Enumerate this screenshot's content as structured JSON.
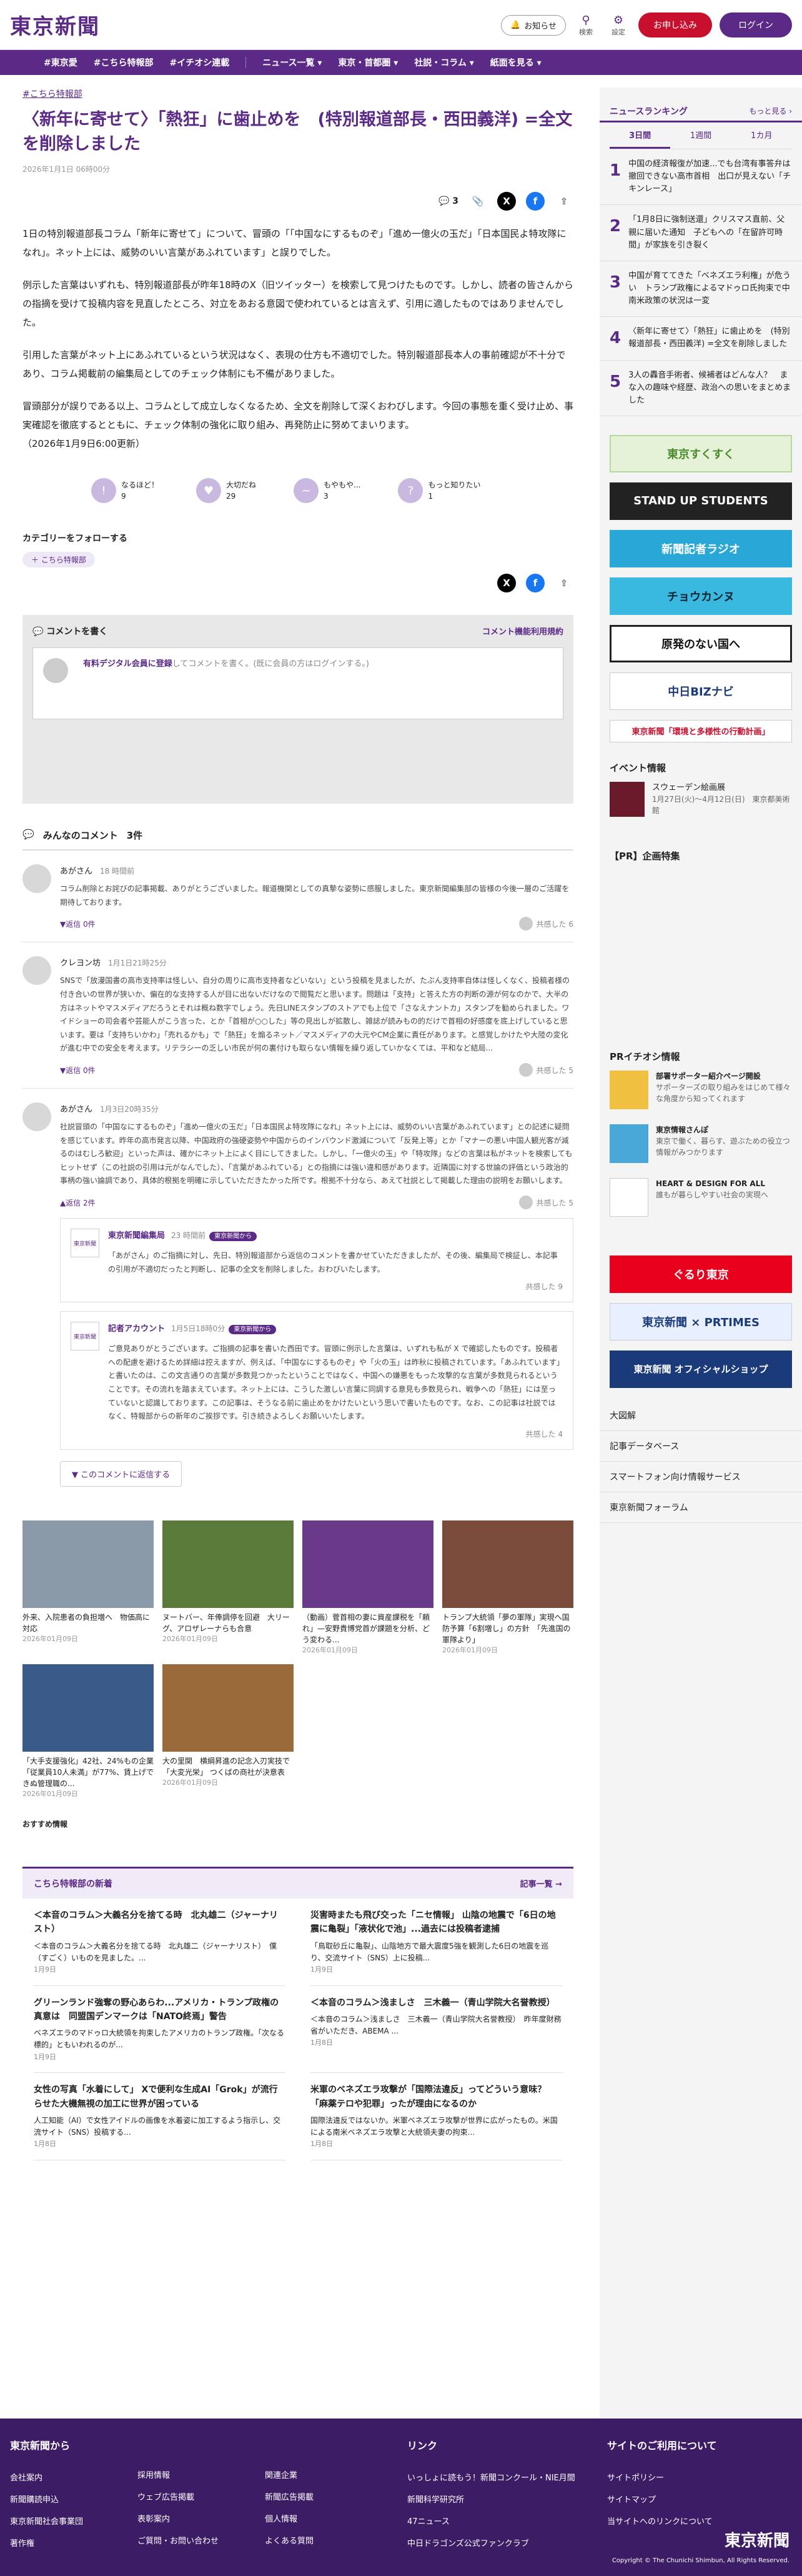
{
  "header": {
    "logo": "東京新聞",
    "notify": "お知らせ",
    "search": "検索",
    "settings": "設定",
    "apply": "お申し込み",
    "login": "ログイン"
  },
  "nav": [
    "#東京愛",
    "#こちら特報部",
    "#イチオシ連載",
    "ニュース一覧 ▾",
    "東京・首都圏 ▾",
    "社説・コラム ▾",
    "紙面を見る ▾"
  ],
  "article": {
    "category": "#こちら特報部",
    "title": "〈新年に寄せて〉「熱狂」に歯止めを　(特別報道部長・西田義洋) =全文を削除しました",
    "date": "2026年1月1日 06時00分",
    "comment_count": "3",
    "paragraphs": [
      "1日の特別報道部長コラム「新年に寄せて」について、冒頭の「「中国なにするものぞ」「進め一億火の玉だ」「日本国民よ特攻隊になれ」。ネット上には、威勢のいい言葉があふれています」と誤りでした。",
      "例示した言葉はいずれも、特別報道部長が昨年18時のX（旧ツイッター）を検索して見つけたものです。しかし、読者の皆さんからの指摘を受けて投稿内容を見直したところ、対立をあおる意図で使われているとは言えず、引用に適したものではありませんでした。",
      "引用した言葉がネット上にあふれているという状況はなく、表現の仕方も不適切でした。特別報道部長本人の事前確認が不十分であり、コラム掲載前の編集局としてのチェック体制にも不備がありました。",
      "冒頭部分が誤りである以上、コラムとして成立しなくなるため、全文を削除して深くおわびします。今回の事態を重く受け止め、事実確認を徹底するとともに、チェック体制の強化に取り組み、再発防止に努めてまいります。",
      "（2026年1月9日6:00更新）"
    ],
    "reactions": [
      {
        "label": "なるほど！",
        "count": "9",
        "icon": "!"
      },
      {
        "label": "大切だね",
        "count": "29",
        "icon": "♥"
      },
      {
        "label": "もやもや...",
        "count": "3",
        "icon": "~"
      },
      {
        "label": "もっと知りたい",
        "count": "1",
        "icon": "?"
      }
    ],
    "follow_label": "カテゴリーをフォローする",
    "follow_chip": "＋ こちら特報部"
  },
  "comment_box": {
    "heading": "コメントを書く",
    "policy_link": "コメント機能利用規約",
    "prompt_member": "有料デジタル会員に登録",
    "prompt_rest": "してコメントを書く。(既に会員の方はログインする。)"
  },
  "comments_section": {
    "heading": "みんなのコメント",
    "count": "3件"
  },
  "comments": [
    {
      "name": "あがさん",
      "time": "18 時間前",
      "text": "コラム削除とお詫びの記事掲載、ありがとうございました。報道機関としての真摯な姿勢に感服しました。東京新聞編集部の皆様の今後一層のご活躍を期待しております。",
      "reply": "▼返信 0件",
      "agree": "共感した 6"
    },
    {
      "name": "クレヨン坊",
      "time": "1月1日21時25分",
      "text": "SNSで「放漫国書の高市支持率は怪しい、自分の周りに高市支持者などいない」という投稿を見ましたが、たぶん支持率自体は怪しくなく、投稿者様の付き合いの世界が狭いか、偏在的な支持する人が目に出ないだけなので閲覧だと思います。問題は「支持」と答えた方の判断の源が何なのかで、大半の方はネットやマスメディアだろうとそれは概ね数字でしょう。先日LINEスタンプのストアでも上位で「さなえナントカ」スタンプを勧められました。ワイドショーの司会者や芸能人がこう言った、とか「首相が○○した」等の見出しが拡散し、雑誌が読みもの的だけで首相の好感度を底上げしていると思います。要は「支持ちいかわ」「売れるかも」で「熱狂」を煽るネット／マスメディアの大元やCM企業に責任があります。と感覚しかけたや大陸の変化が進む中での安全を考えます。リテラシーの乏しい市民が何の裏付けも取らない情報を繰り返していかなくては、平和など結局...",
      "reply": "▼返信 0件",
      "agree": "共感した 5"
    },
    {
      "name": "あがさん",
      "time": "1月3日20時35分",
      "text": "社説冒頭の「中国なにするものぞ」「進め一億火の玉だ」「日本国民よ特攻隊になれ」ネット上には、威勢のいい言葉があふれています」との記述に疑問を感じています。昨年の高市発言以降、中国政府の強硬姿勢や中国からのインバウンド激減について「反発上等」とか「マナーの悪い中国人観光客が減るのはむしろ歓迎」といった声は、確かにネット上によく目にしてきました。しかし、「一億火の玉」や「特攻隊」などの言葉は私がネットを検索してもヒットせず（この社説の引用は元がなんでした）、「言葉があふれている」との指摘には強い違和感があります。近隣国に対する世論の評価という政治的事柄の強い論調であり、具体的根拠を明確に示していただきたかった所です。根拠不十分なら、あえて社説として掲載した理由の説明をお願いします。",
      "reply": "▲返信 2件",
      "agree": "共感した 5"
    }
  ],
  "replies": [
    {
      "name": "東京新聞編集局",
      "time": "23 時間前",
      "tag": "東京新聞から",
      "text": "「あがさん」のご指摘に対し、先日、特別報道部から返信のコメントを書かせていただきましたが、その後、編集局で検証し、本記事の引用が不適切だったと判断し、記事の全文を削除しました。おわびいたします。",
      "agree": "共感した 9"
    },
    {
      "name": "記者アカウント",
      "time": "1月5日18時0分",
      "tag": "東京新聞から",
      "text": "ご意見ありがとうございます。ご指摘の記事を書いた西田です。冒頭に例示した言葉は、いずれも私が X で確認したものです。投稿者への配慮を避けるため詳細は控えますが、例えば、「中国なにするものぞ」や「火の玉」は昨秋に投稿されています。「あふれています」と書いたのは、この文言通りの言葉が多数見つかったということではなく、中国への嫌悪をもった攻撃的な言葉が多数見られるということです。その流れを踏まえています。ネット上には、こうした激しい言葉に同調する意見も多数見られ、戦争への「熱狂」には至っていないと認識しております。この記事は、そうなる前に歯止めをかけたいという思いで書いたものです。なお、この記事は社説ではなく、特報部からの新年のご挨拶です。引き続きよろしくお願いいたします。",
      "agree": "共感した 4"
    }
  ],
  "more_replies": "▼ このコメントに返信する",
  "related": [
    {
      "title": "外来、入院患者の負担増へ　物価高に対応",
      "date": "2026年01月09日",
      "color": "#8a9aa8"
    },
    {
      "title": "ヌートバー、年俸調停を回避　大リーグ、アロザレーナらも合意",
      "date": "2026年01月09日",
      "color": "#5a7a3a"
    },
    {
      "title": "（動画）菅首相の妻に資産課税を「頼れ」—安野貴博党首が課題を分析、どう変わる...",
      "date": "2026年01月09日",
      "color": "#6a3a8a"
    },
    {
      "title": "トランプ大統領「夢の軍隊」実現へ国防予算「6割増し」の方針　「先進国の軍隊より」",
      "date": "2026年01月09日",
      "color": "#7a4a3a"
    },
    {
      "title": "「大手支援強化」42社、24%もの企業「従業員10人未満」が77%、賃上げできぬ管理職の...",
      "date": "2026年01月09日",
      "color": "#3a5a8a"
    },
    {
      "title": "大の里関　横綱昇進の記念入刃実技で「大変光栄」 つくばの商社が決意表",
      "date": "2026年01月09日",
      "color": "#9a6a3a"
    }
  ],
  "recommend_label": "おすすめ情報",
  "latest": {
    "heading": "こちら特報部の新着",
    "more": "記事一覧 →",
    "items": [
      {
        "title": "＜本音のコラム＞大義名分を捨てる時　北丸雄二（ジャーナリスト）",
        "text": "＜本音のコラム＞大義名分を捨てる時　北丸雄二（ジャーナリスト）　僕（すごく）いものを見ました。...",
        "date": "1月9日"
      },
      {
        "title": "災害時またも飛び交った「ニセ情報」 山陰の地震で「6日の地震に亀裂」「液状化で池」...過去には投稿者逮捕",
        "text": "「鳥取砂丘に亀裂」、山陰地方で最大震度5強を観測した6日の地震を巡り、交流サイト（SNS）上に投稿...",
        "date": "1月9日"
      },
      {
        "title": "グリーンランド強奪の野心あらわ...アメリカ・トランプ政権の真意は　同盟国デンマークは「NATO終焉」警告",
        "text": "ベネズエラのマドゥロ大統領を拘束したアメリカのトランプ政権。「次なる標的」ともいわれるのが...",
        "date": "1月9日"
      },
      {
        "title": "＜本音のコラム＞浅ましさ　三木義一（青山学院大名誉教授）",
        "text": "＜本音のコラム＞浅ましさ　三木義一（青山学院大名誉教授）　昨年度財務省がいただき、ABEMA ...",
        "date": "1月8日"
      },
      {
        "title": "女性の写真「水着にして」 Xで便利な生成AI「Grok」が流行らせた大機無視の加工に世界が困っている",
        "text": "人工知能（AI）で女性アイドルの画像を水着姿に加工するよう指示し、交流サイト（SNS）投稿する...",
        "date": "1月8日"
      },
      {
        "title": "米軍のベネズエラ攻撃が「国際法違反」ってどういう意味？「麻薬テロや犯罪」ったが理由になるのか",
        "text": "国際法違反ではないか。米軍ベネズエラ攻撃が世界に広がったもの。米国による南米ベネズエラ攻撃と大統領夫妻の拘束...",
        "date": "1月8日"
      }
    ]
  },
  "ranking": {
    "heading": "ニュースランキング",
    "more": "もっと見る ›",
    "tabs": [
      "3日間",
      "1週間",
      "1カ月"
    ],
    "items": [
      {
        "n": "1",
        "text": "中国の経済報復が加速...でも台湾有事答弁は撤回できない高市首相　出口が見えない「チキンレース」"
      },
      {
        "n": "2",
        "text": "「1月8日に強制送還」クリスマス直前、父親に届いた通知　子どもへの「在留許可時間」が家族を引き裂く"
      },
      {
        "n": "3",
        "text": "中国が育ててきた「ベネズエラ利権」が危うい　トランプ政権によるマドゥロ氏拘束で中南米政策の状況は一変"
      },
      {
        "n": "4",
        "text": "〈新年に寄せて〉「熱狂」に歯止めを　(特別報道部長・西田義洋) =全文を削除しました"
      },
      {
        "n": "5",
        "text": "3人の轟音手術者、候補者はどんな人？　まな入の趣味や経歴、政治への思いをまとめました"
      }
    ]
  },
  "banners": [
    "東京すくすく",
    "STAND UP STUDENTS",
    "新聞記者ラジオ",
    "チョウカンヌ",
    "原発のない国へ",
    "中日BIZナビ",
    "東京新聞「環境と多様性の行動計画」"
  ],
  "event": {
    "heading": "イベント情報",
    "title": "スウェーデン絵画展",
    "text": "1月27日(火)〜4月12日(日)　東京都美術館"
  },
  "pr_heading": "【PR】企画特集",
  "pr_ichioshi": "PRイチオシ情報",
  "pr_items": [
    {
      "title": "部署サポーター紹介ページ開設",
      "text": "サポーターズの取り組みをはじめて様々な角度から知ってくれます"
    },
    {
      "title": "東京情報さんぽ",
      "text": "東京で働く、暮らす、遊ぶための役立つ情報がみつかります"
    },
    {
      "title": "HEART & DESIGN FOR ALL",
      "text": "誰もが暮らしやすい社会の実現へ"
    }
  ],
  "side_banners": [
    "ぐるり東京",
    "東京新聞 × PRTIMES",
    "東京新聞 オフィシャルショップ"
  ],
  "side_links": [
    "大図解",
    "記事データベース",
    "スマートフォン向け情報サービス",
    "東京新聞フォーラム"
  ],
  "footer": {
    "col1": "東京新聞から",
    "col1_items": [
      "会社案内",
      "新聞購読申込",
      "東京新聞社会事業団",
      "著作権"
    ],
    "col1b_items": [
      "採用情報",
      "ウェブ広告掲載",
      "表彰案内",
      "ご質問・お問い合わせ"
    ],
    "col1c_items": [
      "関連企業",
      "新聞広告掲載",
      "個人情報",
      "よくある質問"
    ],
    "col2": "リンク",
    "col2_items": [
      "いっしょに読もう！新聞コンクール・NIE月間",
      "新聞科学研究所",
      "47ニュース",
      "中日ドラゴンズ公式ファンクラブ"
    ],
    "col3": "サイトのご利用について",
    "col3_items": [
      "サイトポリシー",
      "サイトマップ",
      "当サイトへのリンクについて"
    ],
    "copyright": "Copyright © The Chunichi Shimbun, All Rights Reserved."
  },
  "colors": {
    "brand": "#5b2a86",
    "apply": "#c8102e"
  }
}
